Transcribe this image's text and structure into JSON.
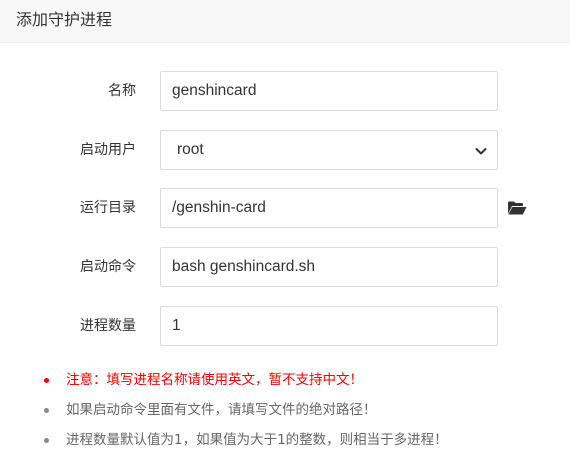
{
  "header": {
    "title": "添加守护进程"
  },
  "form": {
    "name": {
      "label": "名称",
      "value": "genshincard"
    },
    "user": {
      "label": "启动用户",
      "value": "root"
    },
    "dir": {
      "label": "运行目录",
      "value": "/genshin-card"
    },
    "command": {
      "label": "启动命令",
      "value": "bash genshincard.sh"
    },
    "count": {
      "label": "进程数量",
      "value": "1"
    }
  },
  "icons": {
    "folder": "folder-open-icon",
    "chevron": "chevron-down-icon"
  },
  "notes": [
    {
      "text": "注意：填写进程名称请使用英文，暂不支持中文！",
      "color": "#ff0000"
    },
    {
      "text": "如果启动命令里面有文件，请填写文件的绝对路径！",
      "color": "#666666"
    },
    {
      "text": "进程数量默认值为1，如果值为大于1的整数，则相当于多进程！",
      "color": "#666666"
    }
  ]
}
